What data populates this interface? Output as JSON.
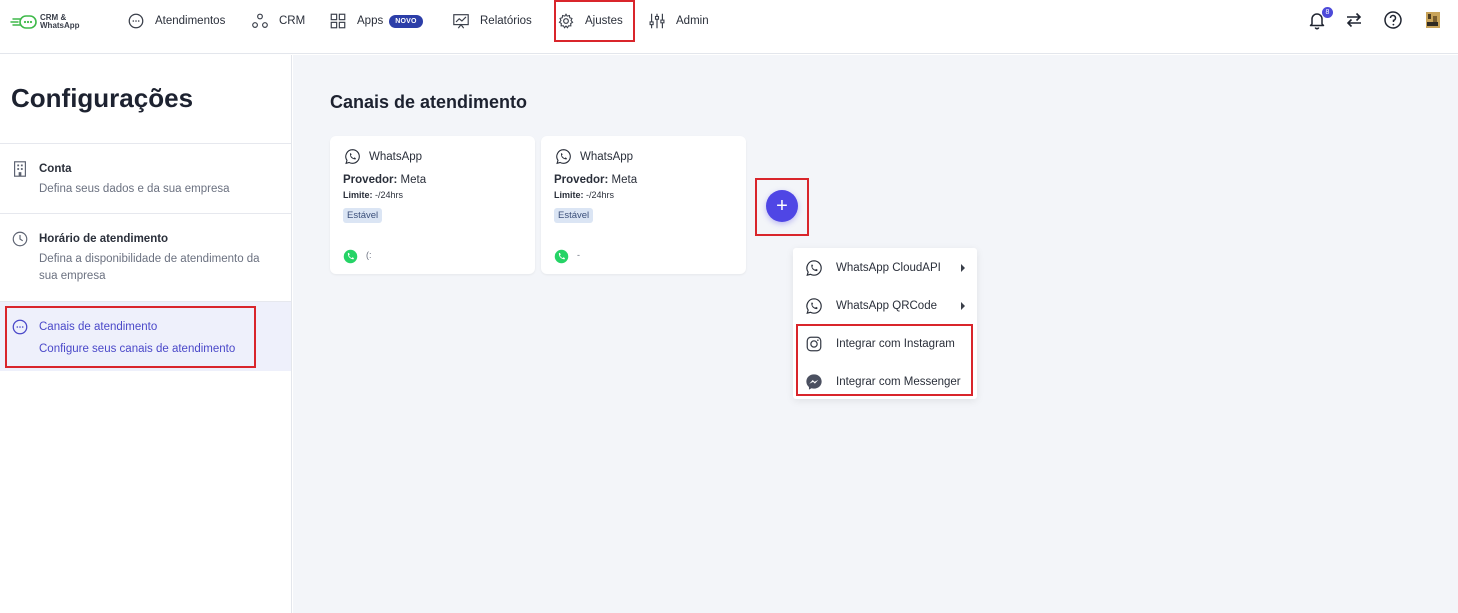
{
  "app": {
    "logo_text_line1": "CRM &",
    "logo_text_line2": "WhatsApp"
  },
  "nav": {
    "items": [
      {
        "label": "Atendimentos"
      },
      {
        "label": "CRM"
      },
      {
        "label": "Apps",
        "badge": "NOVO"
      },
      {
        "label": "Relatórios"
      },
      {
        "label": "Ajustes"
      },
      {
        "label": "Admin"
      }
    ],
    "notification_count": "8"
  },
  "sidebar": {
    "title": "Configurações",
    "items": [
      {
        "label": "Conta",
        "description": "Defina seus dados e da sua empresa"
      },
      {
        "label": "Horário de atendimento",
        "description": "Defina a disponibilidade de atendimento da sua empresa"
      },
      {
        "label": "Canais de atendimento",
        "description": "Configure seus canais de atendimento"
      }
    ]
  },
  "main": {
    "title": "Canais de atendimento",
    "cards": [
      {
        "channel": "WhatsApp",
        "provider_label": "Provedor:",
        "provider": "Meta",
        "limit_label": "Limite:",
        "limit": "-/24hrs",
        "status": "Estável",
        "trail": "(:"
      },
      {
        "channel": "WhatsApp",
        "provider_label": "Provedor:",
        "provider": "Meta",
        "limit_label": "Limite:",
        "limit": "-/24hrs",
        "status": "Estável",
        "trail": "-"
      }
    ],
    "add_button_label": "+",
    "menu": [
      {
        "label": "WhatsApp CloudAPI"
      },
      {
        "label": "WhatsApp QRCode"
      },
      {
        "label": "Integrar com Instagram"
      },
      {
        "label": "Integrar com Messenger"
      }
    ]
  },
  "colors": {
    "accent": "#4f46e5",
    "highlight": "#d9252b",
    "whatsapp_green": "#25d366"
  }
}
